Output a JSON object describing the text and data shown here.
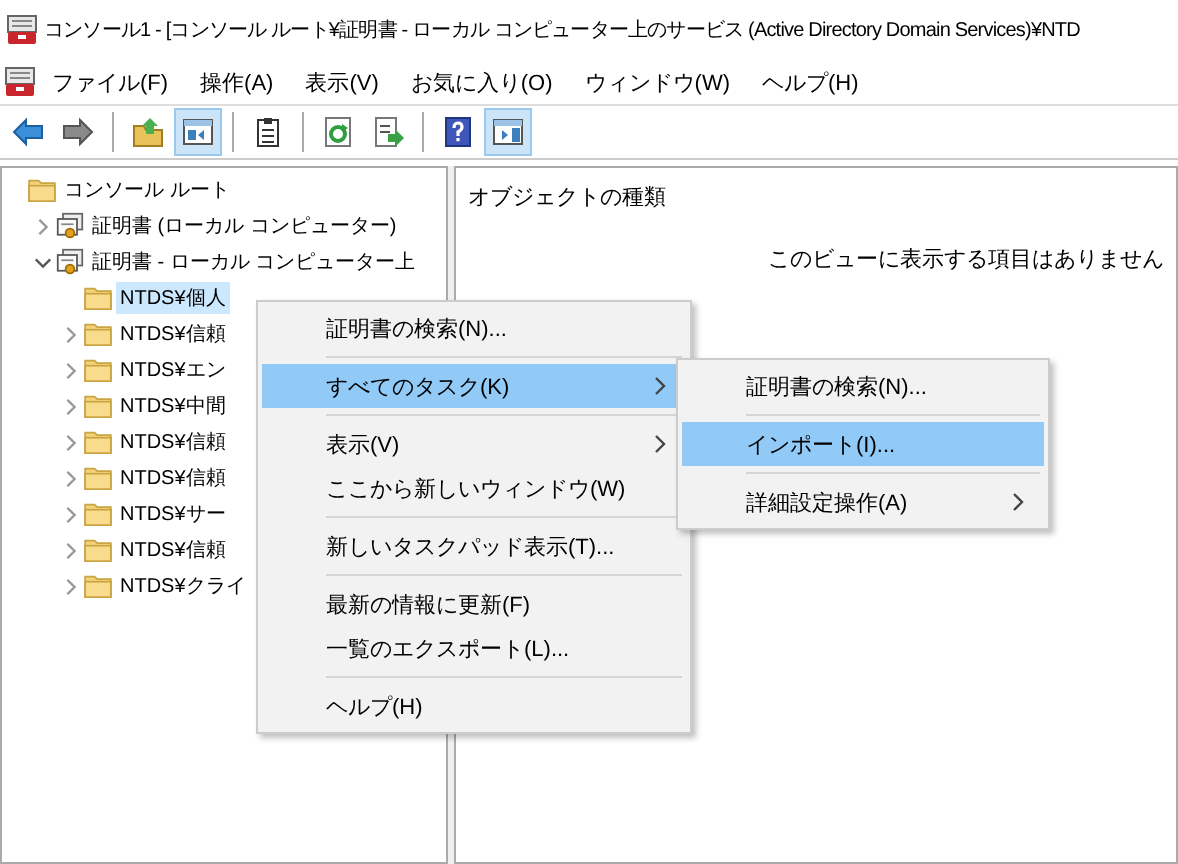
{
  "window": {
    "title": "コンソール1 - [コンソール ルート¥証明書 - ローカル コンピューター上のサービス (Active Directory Domain Services)¥NTD"
  },
  "menu_bar": [
    "ファイル(F)",
    "操作(A)",
    "表示(V)",
    "お気に入り(O)",
    "ウィンドウ(W)",
    "ヘルプ(H)"
  ],
  "toolbar": [
    {
      "kind": "back",
      "pressed": false
    },
    {
      "kind": "forward",
      "pressed": false
    },
    {
      "kind": "sep"
    },
    {
      "kind": "up",
      "pressed": false
    },
    {
      "kind": "tree",
      "pressed": true
    },
    {
      "kind": "sep"
    },
    {
      "kind": "clipboard",
      "pressed": false
    },
    {
      "kind": "sep"
    },
    {
      "kind": "refresh",
      "pressed": false
    },
    {
      "kind": "export",
      "pressed": false
    },
    {
      "kind": "sep"
    },
    {
      "kind": "help",
      "pressed": false
    },
    {
      "kind": "pane",
      "pressed": true
    }
  ],
  "tree": [
    {
      "label": "コンソール ルート",
      "kind": "folder",
      "expandable": false,
      "selected": false,
      "children": [
        {
          "label": "証明書 (ローカル コンピューター)",
          "kind": "certificate",
          "expandable": true,
          "expanded": false,
          "selected": false
        },
        {
          "label": "証明書 - ローカル コンピューター上",
          "kind": "certificate",
          "expandable": true,
          "expanded": true,
          "selected": false,
          "children": [
            {
              "label": "NTDS¥個人",
              "kind": "folder",
              "expandable": false,
              "selected": true
            },
            {
              "label": "NTDS¥信頼",
              "kind": "folder",
              "expandable": true,
              "expanded": false,
              "selected": false
            },
            {
              "label": "NTDS¥エン",
              "kind": "folder",
              "expandable": true,
              "expanded": false,
              "selected": false
            },
            {
              "label": "NTDS¥中間",
              "kind": "folder",
              "expandable": true,
              "expanded": false,
              "selected": false
            },
            {
              "label": "NTDS¥信頼",
              "kind": "folder",
              "expandable": true,
              "expanded": false,
              "selected": false
            },
            {
              "label": "NTDS¥信頼",
              "kind": "folder",
              "expandable": true,
              "expanded": false,
              "selected": false
            },
            {
              "label": "NTDS¥サー",
              "kind": "folder",
              "expandable": true,
              "expanded": false,
              "selected": false
            },
            {
              "label": "NTDS¥信頼",
              "kind": "folder",
              "expandable": true,
              "expanded": false,
              "selected": false
            },
            {
              "label": "NTDS¥クライ",
              "kind": "folder",
              "expandable": true,
              "expanded": false,
              "selected": false
            }
          ]
        }
      ]
    }
  ],
  "content": {
    "column_header": "オブジェクトの種類",
    "empty_message": "このビューに表示する項目はありません"
  },
  "context_menu": [
    {
      "kind": "item",
      "label": "証明書の検索(N)...",
      "submenu": false,
      "selected": false
    },
    {
      "kind": "separator"
    },
    {
      "kind": "item",
      "label": "すべてのタスク(K)",
      "submenu": true,
      "selected": true
    },
    {
      "kind": "separator"
    },
    {
      "kind": "item",
      "label": "表示(V)",
      "submenu": true,
      "selected": false
    },
    {
      "kind": "item",
      "label": "ここから新しいウィンドウ(W)",
      "submenu": false,
      "selected": false
    },
    {
      "kind": "separator"
    },
    {
      "kind": "item",
      "label": "新しいタスクパッド表示(T)...",
      "submenu": false,
      "selected": false
    },
    {
      "kind": "separator"
    },
    {
      "kind": "item",
      "label": "最新の情報に更新(F)",
      "submenu": false,
      "selected": false
    },
    {
      "kind": "item",
      "label": "一覧のエクスポート(L)...",
      "submenu": false,
      "selected": false
    },
    {
      "kind": "separator"
    },
    {
      "kind": "item",
      "label": "ヘルプ(H)",
      "submenu": false,
      "selected": false
    }
  ],
  "submenu": [
    {
      "kind": "item",
      "label": "証明書の検索(N)...",
      "submenu": false,
      "selected": false
    },
    {
      "kind": "separator"
    },
    {
      "kind": "item",
      "label": "インポート(I)...",
      "submenu": false,
      "selected": true
    },
    {
      "kind": "separator"
    },
    {
      "kind": "item",
      "label": "詳細設定操作(A)",
      "submenu": true,
      "selected": false
    }
  ]
}
